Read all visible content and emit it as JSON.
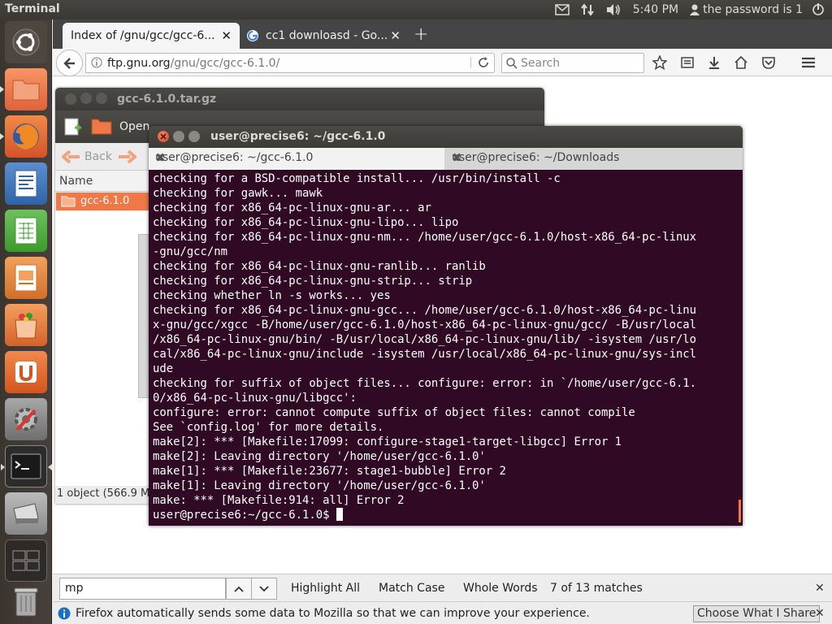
{
  "topbar": {
    "app_title": "Terminal",
    "clock": "5:40 PM",
    "user_label": "the password is 1"
  },
  "launcher": {
    "items": [
      "ubuntu-dash",
      "files",
      "firefox",
      "writer",
      "calc",
      "impress",
      "software-center",
      "ubuntu-one",
      "system-settings",
      "terminal",
      "scanner",
      "workspace-switcher",
      "trash"
    ]
  },
  "firefox": {
    "tabs": [
      {
        "label": "Index of /gnu/gcc/gcc-6...",
        "active": true
      },
      {
        "label": "cc1 downloasd - Go...",
        "active": false
      }
    ],
    "url": {
      "host": "ftp.gnu.org",
      "path": "/gnu/gcc/gcc-6.1.0/"
    },
    "search_placeholder": "Search",
    "findbar": {
      "query": "mp",
      "highlight_all": "Highlight All",
      "match_case": "Match Case",
      "whole_words": "Whole Words",
      "status": "7 of 13 matches"
    },
    "notification": {
      "message": "Firefox automatically sends some data to Mozilla so that we can improve your experience.",
      "button": "Choose What I Share"
    }
  },
  "archive": {
    "title": "gcc-6.1.0.tar.gz",
    "open_label": "Open",
    "back_label": "Back",
    "column_name": "Name",
    "row": "gcc-6.1.0",
    "status": "1 object (566.9 M"
  },
  "terminal": {
    "title": "user@precise6: ~/gcc-6.1.0",
    "tabs": [
      "user@precise6: ~/gcc-6.1.0",
      "user@precise6: ~/Downloads"
    ],
    "lines": [
      "checking for a BSD-compatible install... /usr/bin/install -c",
      "checking for gawk... mawk",
      "checking for x86_64-pc-linux-gnu-ar... ar",
      "checking for x86_64-pc-linux-gnu-lipo... lipo",
      "checking for x86_64-pc-linux-gnu-nm... /home/user/gcc-6.1.0/host-x86_64-pc-linux",
      "-gnu/gcc/nm",
      "checking for x86_64-pc-linux-gnu-ranlib... ranlib",
      "checking for x86_64-pc-linux-gnu-strip... strip",
      "checking whether ln -s works... yes",
      "checking for x86_64-pc-linux-gnu-gcc... /home/user/gcc-6.1.0/host-x86_64-pc-linu",
      "x-gnu/gcc/xgcc -B/home/user/gcc-6.1.0/host-x86_64-pc-linux-gnu/gcc/ -B/usr/local",
      "/x86_64-pc-linux-gnu/bin/ -B/usr/local/x86_64-pc-linux-gnu/lib/ -isystem /usr/lo",
      "cal/x86_64-pc-linux-gnu/include -isystem /usr/local/x86_64-pc-linux-gnu/sys-incl",
      "ude",
      "checking for suffix of object files... configure: error: in `/home/user/gcc-6.1.",
      "0/x86_64-pc-linux-gnu/libgcc':",
      "configure: error: cannot compute suffix of object files: cannot compile",
      "See `config.log' for more details.",
      "make[2]: *** [Makefile:17099: configure-stage1-target-libgcc] Error 1",
      "make[2]: Leaving directory '/home/user/gcc-6.1.0'",
      "make[1]: *** [Makefile:23677: stage1-bubble] Error 2",
      "make[1]: Leaving directory '/home/user/gcc-6.1.0'",
      "make: *** [Makefile:914: all] Error 2"
    ],
    "prompt": "user@precise6:~/gcc-6.1.0$ "
  },
  "colors": {
    "terminal_bg": "#300a24",
    "accent": "#f07746",
    "panel": "#3c3b37"
  }
}
